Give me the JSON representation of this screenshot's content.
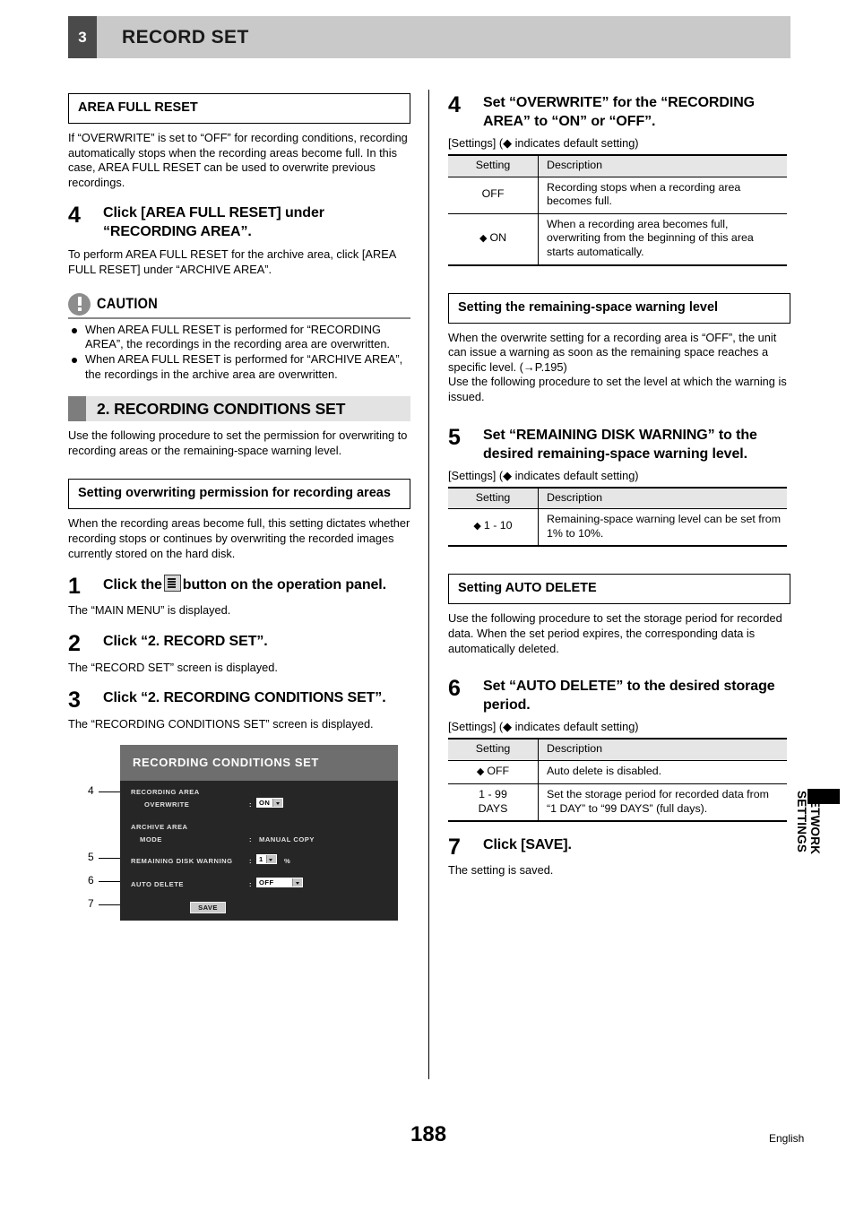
{
  "header": {
    "chapter_number": "3",
    "chapter_title": "RECORD SET"
  },
  "left_column": {
    "box_title_1": "AREA FULL RESET",
    "intro_paragraph": "If “OVERWRITE” is set to “OFF” for recording conditions, recording automatically stops when the recording areas become full. In this case, AREA FULL RESET can be used to overwrite previous recordings.",
    "step4": {
      "number": "4",
      "text": "Click [AREA FULL RESET] under “RECORDING AREA”.",
      "note": "To perform AREA FULL RESET for the archive area, click [AREA FULL RESET] under “ARCHIVE AREA”."
    },
    "caution": {
      "word": "CAUTION",
      "bullets": [
        "When AREA FULL RESET is performed for “RECORDING AREA”, the recordings in the recording area are overwritten.",
        "When AREA FULL RESET is performed for “ARCHIVE AREA”, the recordings in the archive area are overwritten."
      ]
    },
    "section_header": "2. RECORDING CONDITIONS SET",
    "section_intro": "Use the following procedure to set the permission for overwriting to recording areas or the remaining-space warning level.",
    "box_title_2": "Setting overwriting permission for recording areas",
    "box2_intro": "When the recording areas become full, this setting dictates whether recording stops or continues by overwriting the recorded images currently stored on the hard disk.",
    "step1": {
      "number": "1",
      "text_before_icon": "Click the",
      "icon": "menu-button-icon",
      "text_after_icon": "button on the operation panel.",
      "note": "The “MAIN MENU” is displayed."
    },
    "step2": {
      "number": "2",
      "text": "Click “2. RECORD SET”.",
      "note": "The “RECORD SET” screen is displayed."
    },
    "step3": {
      "number": "3",
      "text": "Click “2. RECORDING CONDITIONS SET”.",
      "note": "The “RECORDING CONDITIONS SET” screen is displayed."
    },
    "screen_mock": {
      "title": "RECORDING CONDITIONS SET",
      "group_recording_area": "RECORDING AREA",
      "overwrite_label": "OVERWRITE",
      "overwrite_colon": ":",
      "overwrite_value": "ON",
      "group_archive_area": "ARCHIVE  AREA",
      "mode_label": "MODE",
      "mode_colon": ":",
      "mode_value": "MANUAL COPY",
      "remaining_label": "REMAINING DISK WARNING",
      "remaining_colon": ":",
      "remaining_value": "1",
      "remaining_unit": "%",
      "autodelete_label": "AUTO DELETE",
      "autodelete_colon": ":",
      "autodelete_value": "OFF",
      "save_label": "SAVE",
      "callouts": [
        "4",
        "5",
        "6",
        "7"
      ]
    }
  },
  "right_column": {
    "step4": {
      "number": "4",
      "text": "Set “OVERWRITE” for the “RECORDING AREA” to “ON” or “OFF”."
    },
    "settings_note": "[Settings] (◆ indicates default setting)",
    "table_overwrite": {
      "headers": [
        "Setting",
        "Description"
      ],
      "rows": [
        {
          "setting": "OFF",
          "default": false,
          "description": "Recording stops when a recording area becomes full."
        },
        {
          "setting": "ON",
          "default": true,
          "description": "When a recording area becomes full, overwriting from the beginning of this area starts automatically."
        }
      ]
    },
    "box_title_remaining": "Setting the remaining-space warning level",
    "remaining_intro": "When the overwrite setting for a recording area is “OFF”, the unit can issue a warning as soon as the remaining space reaches a specific level. (→P.195)\nUse the following procedure to set the level at which the warning is issued.",
    "step5": {
      "number": "5",
      "text": "Set “REMAINING DISK WARNING” to the desired remaining-space warning level."
    },
    "table_remaining": {
      "headers": [
        "Setting",
        "Description"
      ],
      "rows": [
        {
          "setting": "1 - 10",
          "default": true,
          "description": "Remaining-space warning level can be set from 1% to 10%."
        }
      ]
    },
    "box_title_autodelete": "Setting AUTO DELETE",
    "autodelete_intro": "Use the following procedure to set the storage period for recorded data. When the set period expires, the corresponding data is automatically deleted.",
    "step6": {
      "number": "6",
      "text": "Set “AUTO DELETE” to the desired storage period."
    },
    "table_autodelete": {
      "headers": [
        "Setting",
        "Description"
      ],
      "rows": [
        {
          "setting": "OFF",
          "default": true,
          "description": "Auto delete is disabled."
        },
        {
          "setting": "1 - 99\nDAYS",
          "default": false,
          "description": "Set the storage period for recorded data from “1 DAY” to “99 DAYS” (full days)."
        }
      ]
    },
    "step7": {
      "number": "7",
      "text": "Click [SAVE].",
      "note": "The setting is saved."
    }
  },
  "side_tab": {
    "line1": "NETWORK",
    "line2": "SETTINGS"
  },
  "footer": {
    "page_number": "188",
    "language": "English"
  }
}
